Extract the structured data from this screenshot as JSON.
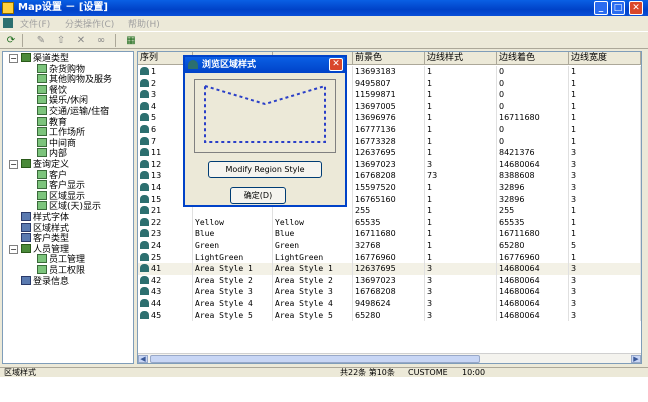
{
  "window": {
    "title": "Map设置 － [设置]"
  },
  "menu": {
    "items": [
      "文件(F)",
      "分类操作(C)",
      "帮助(H)"
    ]
  },
  "tree": {
    "nodes": [
      {
        "label": "渠道类型",
        "icon": "folder-icon",
        "level": 0
      },
      {
        "label": "杂货购物",
        "icon": "doc-icon",
        "level": 1
      },
      {
        "label": "其他购物及服务",
        "icon": "doc-icon",
        "level": 1
      },
      {
        "label": "餐饮",
        "icon": "doc-icon",
        "level": 1
      },
      {
        "label": "娱乐/休闲",
        "icon": "doc-icon",
        "level": 1
      },
      {
        "label": "交通/运输/住宿",
        "icon": "doc-icon",
        "level": 1
      },
      {
        "label": "教育",
        "icon": "doc-icon",
        "level": 1
      },
      {
        "label": "工作场所",
        "icon": "doc-icon",
        "level": 1
      },
      {
        "label": "中间商",
        "icon": "doc-icon",
        "level": 1
      },
      {
        "label": "内部",
        "icon": "doc-icon",
        "level": 1
      },
      {
        "label": "查询定义",
        "icon": "folder-icon",
        "level": 0
      },
      {
        "label": "客户",
        "icon": "doc-icon",
        "level": 1
      },
      {
        "label": "客户显示",
        "icon": "doc-icon",
        "level": 1
      },
      {
        "label": "区域显示",
        "icon": "doc-icon",
        "level": 1
      },
      {
        "label": "区域(天)显示",
        "icon": "doc-icon",
        "level": 1
      },
      {
        "label": "样式字体",
        "icon": "book-icon",
        "level": 0
      },
      {
        "label": "区域样式",
        "icon": "book-icon",
        "level": 0
      },
      {
        "label": "客户类型",
        "icon": "book-icon",
        "level": 0
      },
      {
        "label": "人员管理",
        "icon": "folder-icon",
        "level": 0
      },
      {
        "label": "员工管理",
        "icon": "doc-icon",
        "level": 1
      },
      {
        "label": "员工权限",
        "icon": "doc-icon",
        "level": 1
      },
      {
        "label": "登录信息",
        "icon": "book-icon",
        "level": 0
      }
    ]
  },
  "grid": {
    "headers": [
      "序列",
      "",
      "",
      "前景色",
      "边线样式",
      "边线着色",
      "边线宽度"
    ],
    "rows": [
      {
        "seq": "1",
        "c1": "",
        "c2": "",
        "fg": "13693183",
        "bs": "1",
        "bc": "0",
        "bw": "1"
      },
      {
        "seq": "2",
        "c1": "",
        "c2": "",
        "fg": "9495807",
        "bs": "1",
        "bc": "0",
        "bw": "1"
      },
      {
        "seq": "3",
        "c1": "",
        "c2": "",
        "fg": "11599871",
        "bs": "1",
        "bc": "0",
        "bw": "1"
      },
      {
        "seq": "4",
        "c1": "",
        "c2": "",
        "fg": "13697005",
        "bs": "1",
        "bc": "0",
        "bw": "1"
      },
      {
        "seq": "5",
        "c1": "",
        "c2": "",
        "fg": "13696976",
        "bs": "1",
        "bc": "16711680",
        "bw": "1"
      },
      {
        "seq": "6",
        "c1": "",
        "c2": "",
        "fg": "16777136",
        "bs": "1",
        "bc": "0",
        "bw": "1"
      },
      {
        "seq": "7",
        "c1": "",
        "c2": "",
        "fg": "16773328",
        "bs": "1",
        "bc": "0",
        "bw": "1"
      },
      {
        "seq": "11",
        "c1": "",
        "c2": "",
        "fg": "12637695",
        "bs": "1",
        "bc": "8421376",
        "bw": "3"
      },
      {
        "seq": "12",
        "c1": "",
        "c2": "",
        "fg": "13697023",
        "bs": "3",
        "bc": "14680064",
        "bw": "3"
      },
      {
        "seq": "13",
        "c1": "",
        "c2": "",
        "fg": "16768208",
        "bs": "73",
        "bc": "8388608",
        "bw": "3"
      },
      {
        "seq": "14",
        "c1": "",
        "c2": "",
        "fg": "15597520",
        "bs": "1",
        "bc": "32896",
        "bw": "3"
      },
      {
        "seq": "15",
        "c1": "",
        "c2": "",
        "fg": "16765160",
        "bs": "1",
        "bc": "32896",
        "bw": "3"
      },
      {
        "seq": "21",
        "c1": "",
        "c2": "",
        "fg": "255",
        "bs": "1",
        "bc": "255",
        "bw": "1"
      },
      {
        "seq": "22",
        "c1": "Yellow",
        "c2": "Yellow",
        "fg": "65535",
        "bs": "1",
        "bc": "65535",
        "bw": "1"
      },
      {
        "seq": "23",
        "c1": "Blue",
        "c2": "Blue",
        "fg": "16711680",
        "bs": "1",
        "bc": "16711680",
        "bw": "1"
      },
      {
        "seq": "24",
        "c1": "Green",
        "c2": "Green",
        "fg": "32768",
        "bs": "1",
        "bc": "65280",
        "bw": "5"
      },
      {
        "seq": "25",
        "c1": "LightGreen",
        "c2": "LightGreen",
        "fg": "16776960",
        "bs": "1",
        "bc": "16776960",
        "bw": "1"
      },
      {
        "seq": "41",
        "c1": "Area Style 1",
        "c2": "Area Style 1",
        "fg": "12637695",
        "bs": "3",
        "bc": "14680064",
        "bw": "3"
      },
      {
        "seq": "42",
        "c1": "Area Style 2",
        "c2": "Area Style 2",
        "fg": "13697023",
        "bs": "3",
        "bc": "14680064",
        "bw": "3"
      },
      {
        "seq": "43",
        "c1": "Area Style 3",
        "c2": "Area Style 3",
        "fg": "16768208",
        "bs": "3",
        "bc": "14680064",
        "bw": "3"
      },
      {
        "seq": "44",
        "c1": "Area Style 4",
        "c2": "Area Style 4",
        "fg": "9498624",
        "bs": "3",
        "bc": "14680064",
        "bw": "3"
      },
      {
        "seq": "45",
        "c1": "Area Style 5",
        "c2": "Area Style 5",
        "fg": "65280",
        "bs": "3",
        "bc": "14680064",
        "bw": "3"
      }
    ]
  },
  "dialog": {
    "title": "浏览区域样式",
    "modify_label": "Modify Region Style",
    "ok_label": "确定(D)"
  },
  "status": {
    "segments": [
      "区域样式",
      "共22条 第10条",
      "CUSTOME",
      "10:00"
    ]
  },
  "colors": {
    "accent": "#0042c8",
    "row_icon": "#2c6f6f",
    "preview_border": "#2a3fc8"
  }
}
